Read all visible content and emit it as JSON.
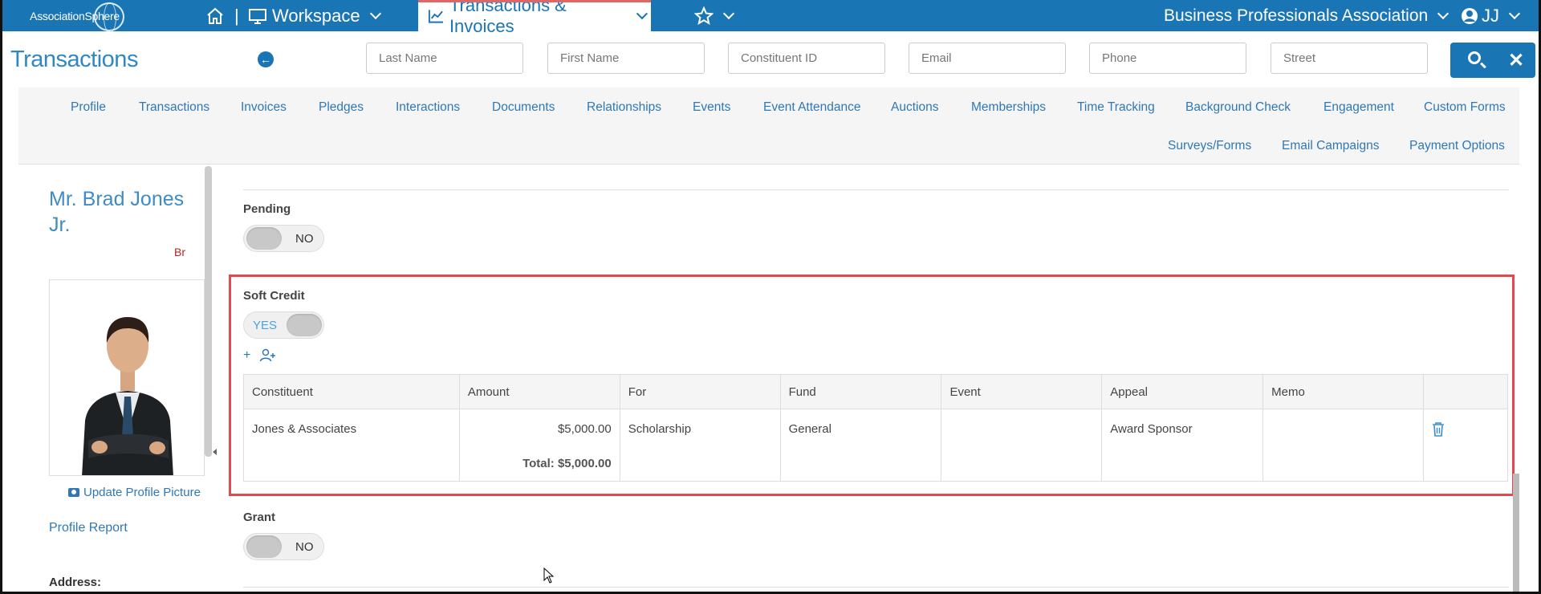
{
  "topbar": {
    "logo": "AssociationSphere",
    "workspace": "Workspace",
    "active_tab": "Transactions & Invoices",
    "separator": "|",
    "org": "Business Professionals Association",
    "user_initials": "JJ",
    "bg_color": "#1a75b5"
  },
  "page": {
    "title": "Transactions"
  },
  "search": {
    "last_name": "Last Name",
    "first_name": "First Name",
    "constituent_id": "Constituent ID",
    "email": "Email",
    "phone": "Phone",
    "street": "Street",
    "close_symbol": "✕"
  },
  "nav": {
    "row1": [
      "Profile",
      "Transactions",
      "Invoices",
      "Pledges",
      "Interactions",
      "Documents",
      "Relationships",
      "Events",
      "Event Attendance",
      "Auctions",
      "Memberships",
      "Time Tracking",
      "Background Check",
      "Engagement",
      "Custom Forms"
    ],
    "row2": [
      "Surveys/Forms",
      "Email Campaigns",
      "Payment Options"
    ]
  },
  "profile": {
    "name": "Mr. Brad Jones Jr.",
    "badge_fragment": "Br",
    "update_picture": "Update Profile Picture",
    "profile_report": "Profile Report",
    "address_label": "Address:"
  },
  "form": {
    "pending": {
      "label": "Pending",
      "value": "NO"
    },
    "soft_credit": {
      "label": "Soft Credit",
      "value": "YES",
      "add_symbol": "+"
    },
    "grant": {
      "label": "Grant",
      "value": "NO"
    }
  },
  "soft_credit_table": {
    "headers": [
      "Constituent",
      "Amount",
      "For",
      "Fund",
      "Event",
      "Appeal",
      "Memo",
      ""
    ],
    "rows": [
      {
        "constituent": "Jones & Associates",
        "amount": "$5,000.00",
        "for": "Scholarship",
        "fund": "General",
        "event": "",
        "appeal": "Award Sponsor",
        "memo": ""
      }
    ],
    "total": "Total: $5,000.00"
  },
  "colors": {
    "accent": "#1a75b5",
    "link": "#2f78b5",
    "highlight_border": "#e2484f",
    "toggle_yes": "#4aa3df"
  }
}
